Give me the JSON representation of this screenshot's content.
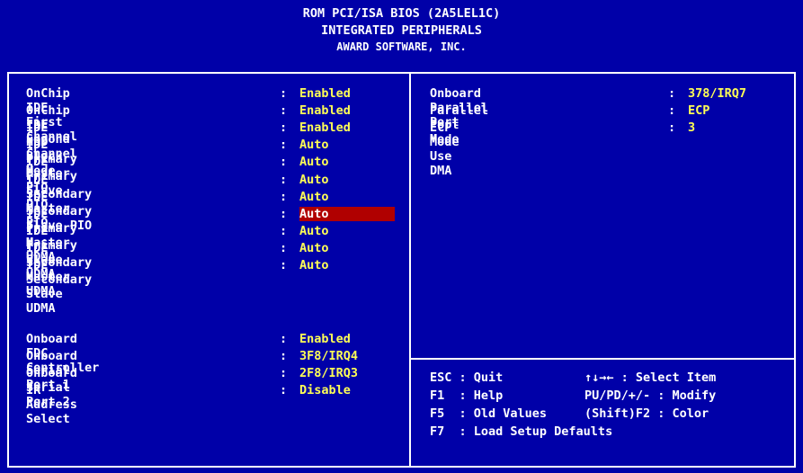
{
  "colors": {
    "background": "#0000a8",
    "value": "#ffff55",
    "highlight": "#b00000",
    "text": "#ffffff"
  },
  "header": {
    "line1": "ROM PCI/ISA BIOS (2A5LEL1C)",
    "line2": "INTEGRATED PERIPHERALS",
    "line3": "AWARD SOFTWARE, INC."
  },
  "left_settings": [
    {
      "label": "OnChip IDE First Channel",
      "sep": ":",
      "value": "Enabled"
    },
    {
      "label": "OnChip IDE Second Channel",
      "sep": ":",
      "value": "Enabled"
    },
    {
      "label": "IDE HDD Block Mode",
      "sep": ":",
      "value": "Enabled"
    },
    {
      "label": "IDE Primary Master PIO",
      "sep": ":",
      "value": "Auto"
    },
    {
      "label": "IDE Primary Slave  PIO",
      "sep": ":",
      "value": "Auto"
    },
    {
      "label": "IDE Secondary Master PIO",
      "sep": ":",
      "value": "Auto"
    },
    {
      "label": "IDE Secondary Slave  PIO",
      "sep": ":",
      "value": "Auto"
    },
    {
      "label": "IDE Primary Master UDMA",
      "sep": ":",
      "value": "Auto",
      "selected": true
    },
    {
      "label": "IDE Primary Slave  UDMA",
      "sep": ":",
      "value": "Auto"
    },
    {
      "label": "IDE Secondary Master UDMA",
      "sep": ":",
      "value": "Auto"
    },
    {
      "label": "IDE Secondary Slave  UDMA",
      "sep": ":",
      "value": "Auto"
    }
  ],
  "left_settings_2": [
    {
      "label": "Onboard FDC Controller",
      "sep": ":",
      "value": "Enabled"
    },
    {
      "label": "Onboard Serial Port 1",
      "sep": ":",
      "value": "3F8/IRQ4"
    },
    {
      "label": "Onboard Serial Port 2",
      "sep": ":",
      "value": "2F8/IRQ3"
    },
    {
      "label": "IR Address Select",
      "sep": ":",
      "value": "Disable"
    }
  ],
  "right_settings": [
    {
      "label": "Onboard Parallel Port",
      "sep": ":",
      "value": "378/IRQ7"
    },
    {
      "label": "Parallel Port Mode",
      "sep": ":",
      "value": "ECP"
    },
    {
      "label": "ECP Mode Use DMA",
      "sep": ":",
      "value": "3"
    }
  ],
  "help": {
    "esc": "ESC : Quit",
    "select": "↑↓→← : Select Item",
    "f1": "F1  : Help",
    "modify": "PU/PD/+/- : Modify",
    "f5": "F5  : Old Values",
    "color": "(Shift)F2 : Color",
    "f7": "F7  : Load Setup Defaults"
  }
}
